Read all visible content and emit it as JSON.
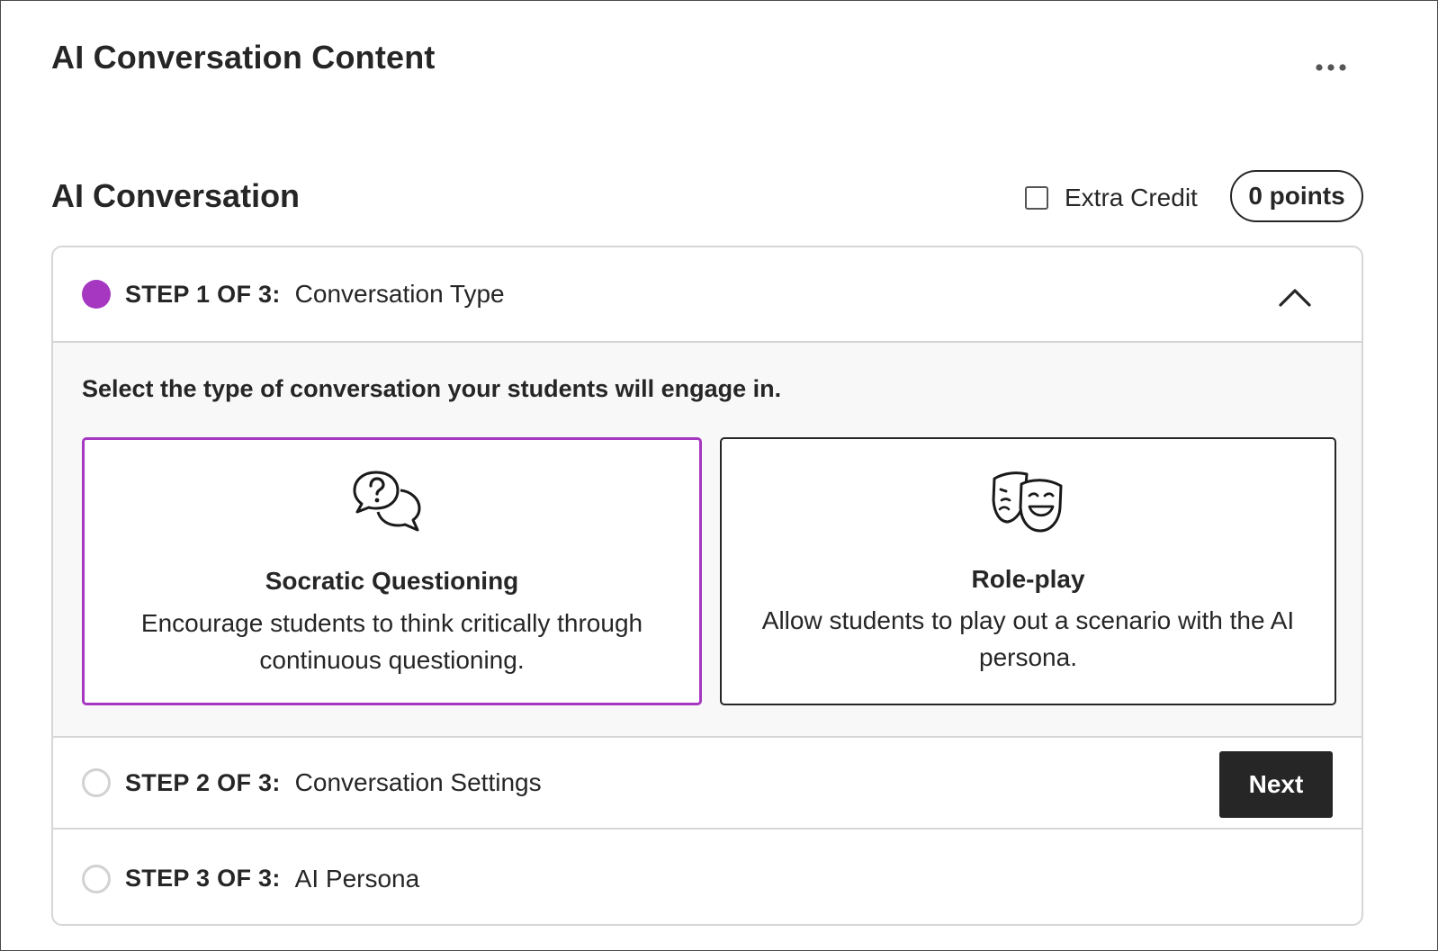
{
  "page": {
    "title": "AI Conversation Content",
    "more_icon": "more-horizontal-icon"
  },
  "section": {
    "title": "AI Conversation",
    "extra_credit_label": "Extra Credit",
    "extra_credit_checked": false,
    "points_label": "0 points"
  },
  "steps": [
    {
      "label": "STEP 1 OF 3:",
      "name": "Conversation Type",
      "status": "active",
      "expanded": true,
      "instruction": "Select the type of conversation your students will engage in.",
      "options": [
        {
          "title": "Socratic Questioning",
          "description": "Encourage students to think critically through continuous questioning.",
          "icon": "question-speech-bubbles-icon",
          "selected": true
        },
        {
          "title": "Role-play",
          "description": "Allow students to play out a scenario with the AI persona.",
          "icon": "theater-masks-icon",
          "selected": false
        }
      ]
    },
    {
      "label": "STEP 2 OF 3:",
      "name": "Conversation Settings",
      "status": "inactive",
      "next_label": "Next"
    },
    {
      "label": "STEP 3 OF 3:",
      "name": "AI Persona",
      "status": "inactive"
    }
  ],
  "colors": {
    "accent": "#a537c1",
    "text": "#262626",
    "border": "#d6d6d6",
    "panel_bg": "#f8f8f8",
    "button_bg": "#262626"
  }
}
